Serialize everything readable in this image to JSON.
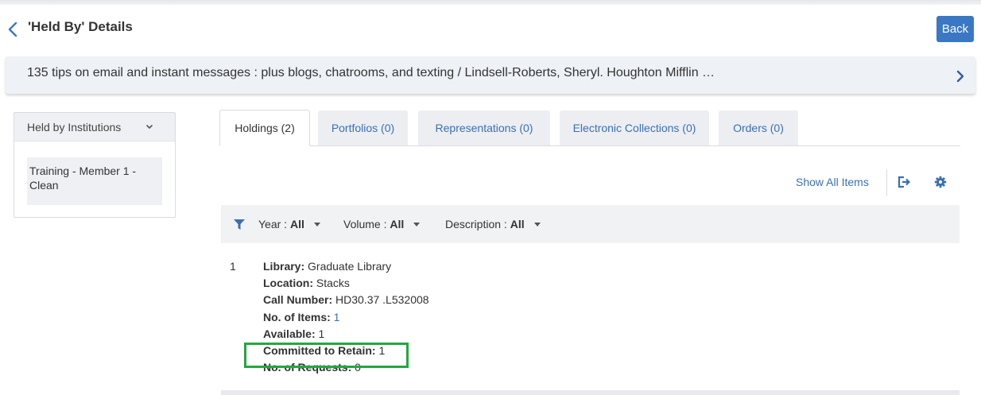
{
  "header": {
    "title": "'Held By' Details",
    "back_label": "Back",
    "back_icon": "chevron-left-icon"
  },
  "record": {
    "title": "135 tips on email and instant messages : plus blogs, chatrooms, and texting / Lindsell-Roberts, Sheryl. Houghton Mifflin …",
    "expand_icon": "chevron-right-icon"
  },
  "institutions": {
    "dropdown_label": "Held by Institutions",
    "items": [
      {
        "label": "Training - Member 1 - Clean"
      }
    ]
  },
  "tabs": [
    {
      "label": "Holdings (2)",
      "active": true
    },
    {
      "label": "Portfolios (0)",
      "active": false
    },
    {
      "label": "Representations (0)",
      "active": false
    },
    {
      "label": "Electronic Collections (0)",
      "active": false
    },
    {
      "label": "Orders (0)",
      "active": false
    }
  ],
  "actions": {
    "show_all_items": "Show All Items",
    "export_icon": "export-icon",
    "settings_icon": "gear-icon"
  },
  "filters": {
    "icon": "filter-icon",
    "items": [
      {
        "label": "Year : ",
        "value": "All"
      },
      {
        "label": "Volume : ",
        "value": "All"
      },
      {
        "label": "Description : ",
        "value": "All"
      }
    ]
  },
  "holdings": [
    {
      "index": "1",
      "library_label": "Library:",
      "library": "Graduate Library",
      "location_label": "Location:",
      "location": "Stacks",
      "call_number_label": "Call Number:",
      "call_number": "HD30.37 .L532008",
      "items_label": "No. of Items:",
      "items": "1",
      "available_label": "Available:",
      "available": "1",
      "committed_label": "Committed to Retain:",
      "committed": "1",
      "requests_label": "No. of Requests:",
      "requests": "0"
    }
  ],
  "colors": {
    "accent": "#3a78c4",
    "link": "#3a6fb5",
    "highlight": "#26a641"
  }
}
